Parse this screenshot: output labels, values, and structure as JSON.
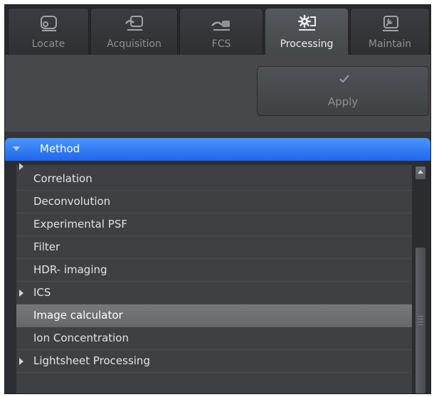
{
  "tabs": [
    {
      "label": "Locate",
      "icon": "locate-icon",
      "active": false
    },
    {
      "label": "Acquisition",
      "icon": "acquisition-icon",
      "active": false
    },
    {
      "label": "FCS",
      "icon": "fcs-icon",
      "active": false
    },
    {
      "label": "Processing",
      "icon": "gear-icon",
      "active": true
    },
    {
      "label": "Maintain",
      "icon": "maintain-icon",
      "active": false
    }
  ],
  "toolbar": {
    "apply_label": "Apply",
    "apply_icon": "checkmark-icon"
  },
  "method": {
    "title": "Method",
    "items": [
      {
        "label": "Correlation",
        "expandable": false,
        "selected": false
      },
      {
        "label": "Deconvolution",
        "expandable": false,
        "selected": false
      },
      {
        "label": "Experimental PSF",
        "expandable": false,
        "selected": false
      },
      {
        "label": "Filter",
        "expandable": false,
        "selected": false
      },
      {
        "label": "HDR- imaging",
        "expandable": false,
        "selected": false
      },
      {
        "label": "ICS",
        "expandable": true,
        "selected": false
      },
      {
        "label": "Image calculator",
        "expandable": false,
        "selected": true
      },
      {
        "label": "Ion Concentration",
        "expandable": false,
        "selected": false
      },
      {
        "label": "Lightsheet Processing",
        "expandable": true,
        "selected": false
      }
    ]
  },
  "colors": {
    "accent": "#2f7bf5",
    "panel": "#343639",
    "selected_row": "#6f7175"
  }
}
